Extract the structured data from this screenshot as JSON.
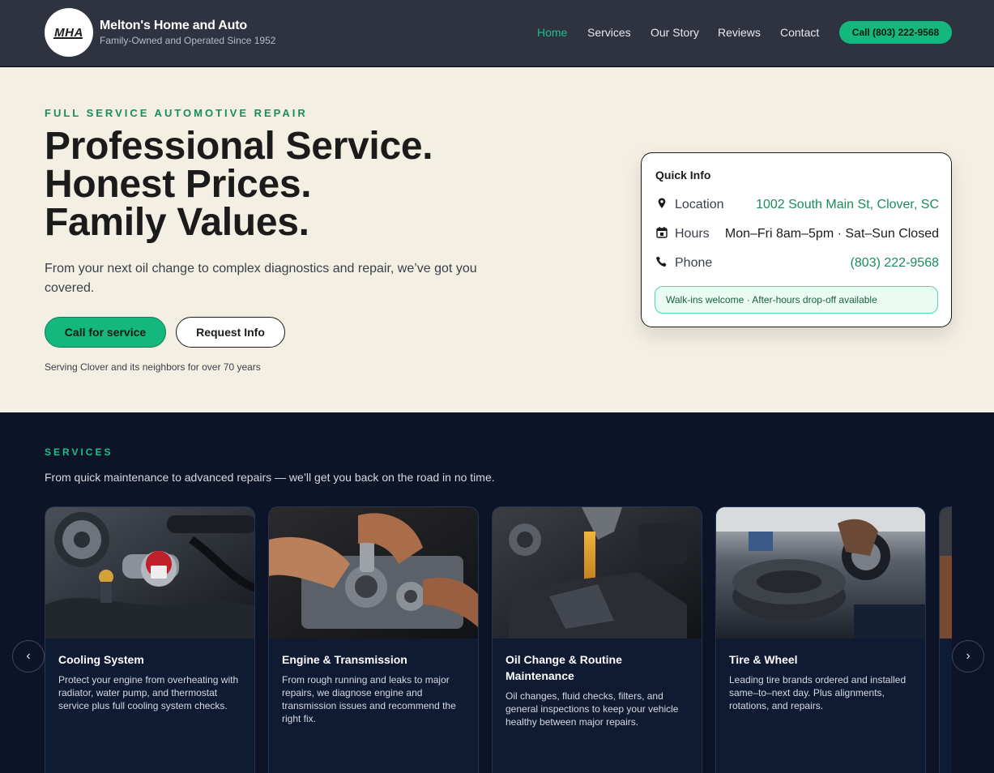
{
  "header": {
    "logo_text": "MHA",
    "brand_name": "Melton's Home and Auto",
    "tagline": "Family-Owned and Operated Since 1952",
    "nav": [
      {
        "label": "Home",
        "active": true
      },
      {
        "label": "Services",
        "active": false
      },
      {
        "label": "Our Story",
        "active": false
      },
      {
        "label": "Reviews",
        "active": false
      },
      {
        "label": "Contact",
        "active": false
      }
    ],
    "call_button": "Call (803) 222-9568"
  },
  "hero": {
    "eyebrow": "FULL SERVICE AUTOMOTIVE REPAIR",
    "headline": [
      "Professional Service.",
      "Honest Prices.",
      "Family Values."
    ],
    "subtitle": "From your next oil change to complex diagnostics and repair, we’ve got you covered.",
    "primary_button": "Call for service",
    "secondary_button": "Request Info",
    "note": "Serving Clover and its neighbors for over 70 years"
  },
  "quick_info": {
    "title": "Quick Info",
    "rows": [
      {
        "icon": "map-pin-icon",
        "label": "Location",
        "value": "1002 South Main St, Clover, SC"
      },
      {
        "icon": "calendar-icon",
        "label": "Hours",
        "value": "Mon–Fri 8am–5pm · Sat–Sun Closed"
      },
      {
        "icon": "phone-icon",
        "label": "Phone",
        "value": "(803) 222-9568"
      }
    ],
    "notice": "Walk-ins welcome · After-hours drop-off available"
  },
  "services": {
    "eyebrow": "SERVICES",
    "subtitle": "From quick maintenance to advanced repairs — we’ll get you back on the road in no time.",
    "cards": [
      {
        "title": "Cooling System",
        "text": "Protect your engine from overheating with radiator, water pump, and thermostat service plus full cooling system checks."
      },
      {
        "title": "Engine & Transmission",
        "text": "From rough running and leaks to major repairs, we diagnose engine and transmission issues and recommend the right fix."
      },
      {
        "title": "Oil Change & Routine Maintenance",
        "text": "Oil changes, fluid checks, filters, and general inspections to keep your vehicle healthy between major repairs."
      },
      {
        "title": "Tire & Wheel",
        "text": "Leading tire brands ordered and installed same–to–next day. Plus alignments, rotations, and repairs."
      }
    ],
    "prev_arrow": "‹",
    "next_arrow": "›"
  },
  "colors": {
    "accent": "#14b87e",
    "header_bg": "#2f3340",
    "hero_bg": "#f3efe3",
    "services_bg": "#0d1428"
  }
}
